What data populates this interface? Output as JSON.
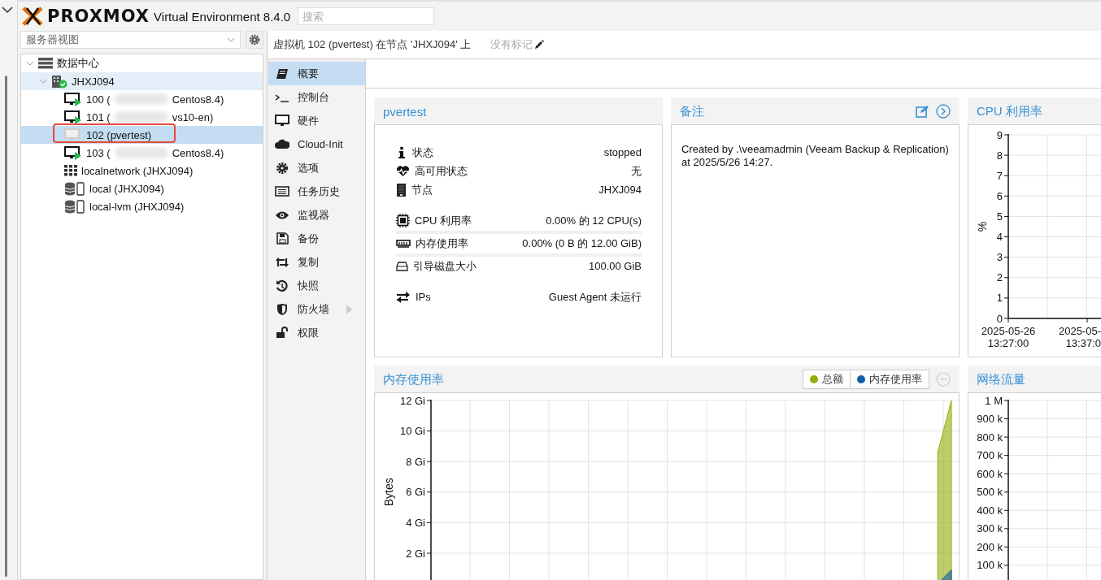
{
  "header": {
    "logo": "PROXMOX",
    "product": "Virtual Environment 8.4.0",
    "search": {
      "placeholder": "搜索"
    }
  },
  "sidebar": {
    "view_selector": {
      "value": "服务器视图"
    },
    "tree": [
      {
        "kind": "datacenter",
        "label": "数据中心",
        "expanded": true,
        "selected": false,
        "highlighted": false,
        "circled": false,
        "children": [
          {
            "kind": "node",
            "label": "JHXJ094",
            "expanded": true,
            "selected": false,
            "highlighted": true,
            "circled": false,
            "children": [
              {
                "kind": "vm",
                "label": "100 (",
                "label_end": "Centos8.4)",
                "running": true,
                "selected": false,
                "highlighted": false,
                "circled": false
              },
              {
                "kind": "vm",
                "label": "101 (",
                "label_end": "vs10-en)",
                "running": true,
                "selected": false,
                "highlighted": false,
                "circled": false
              },
              {
                "kind": "vm",
                "label": "102 (pvertest)",
                "running": false,
                "selected": true,
                "highlighted": false,
                "circled": true
              },
              {
                "kind": "vm",
                "label": "103 (",
                "label_end": "Centos8.4)",
                "running": true,
                "selected": false,
                "highlighted": false,
                "circled": false
              },
              {
                "kind": "sdn",
                "label": "localnetwork (JHXJ094)",
                "selected": false,
                "highlighted": false,
                "circled": false
              },
              {
                "kind": "storage",
                "label": "local (JHXJ094)",
                "selected": false,
                "highlighted": false,
                "circled": false
              },
              {
                "kind": "storage",
                "label": "local-lvm (JHXJ094)",
                "selected": false,
                "highlighted": false,
                "circled": false
              }
            ]
          }
        ]
      }
    ]
  },
  "title_bar": {
    "title": "虚拟机 102 (pvertest) 在节点 'JHXJ094' 上",
    "tags": "没有标记"
  },
  "menu": [
    {
      "label": "概要",
      "selected": true,
      "has_submenu": false
    },
    {
      "label": "控制台",
      "selected": false,
      "has_submenu": false
    },
    {
      "label": "硬件",
      "selected": false,
      "has_submenu": false
    },
    {
      "label": "Cloud-Init",
      "selected": false,
      "has_submenu": false
    },
    {
      "label": "选项",
      "selected": false,
      "has_submenu": false
    },
    {
      "label": "任务历史",
      "selected": false,
      "has_submenu": false
    },
    {
      "label": "监视器",
      "selected": false,
      "has_submenu": false
    },
    {
      "label": "备份",
      "selected": false,
      "has_submenu": false
    },
    {
      "label": "复制",
      "selected": false,
      "has_submenu": false
    },
    {
      "label": "快照",
      "selected": false,
      "has_submenu": false
    },
    {
      "label": "防火墙",
      "selected": false,
      "has_submenu": true
    },
    {
      "label": "权限",
      "selected": false,
      "has_submenu": false
    }
  ],
  "summary": {
    "title": "pvertest",
    "sections": [
      {
        "rows": [
          {
            "kind": "info",
            "label": "状态",
            "value": "stopped"
          },
          {
            "kind": "info",
            "label": "高可用状态",
            "value": "无"
          },
          {
            "kind": "info",
            "label": "节点",
            "value": "JHXJ094"
          }
        ]
      },
      {
        "rows": [
          {
            "kind": "bar",
            "label": "CPU 利用率",
            "value": "0.00% 的 12 CPU(s)",
            "level": 0
          },
          {
            "kind": "bar",
            "label": "内存使用率",
            "value": "0.00% (0 B 的 12.00 GiB)",
            "level": 0
          },
          {
            "kind": "info",
            "label": "引导磁盘大小",
            "value": "100.00 GiB"
          }
        ]
      },
      {
        "rows": [
          {
            "kind": "info",
            "label": "IPs",
            "value": "Guest Agent 未运行"
          }
        ]
      }
    ]
  },
  "notes": {
    "title": "备注",
    "text": "Created by .\\veeamadmin (Veeam Backup & Replication) at 2025/5/26 14:27."
  },
  "cpu": {
    "title": "CPU 利用率",
    "chart_data": {
      "type": "line",
      "grid": true,
      "ylabel": "%",
      "ylim": [
        0,
        9
      ],
      "yticks": [
        0,
        1,
        2,
        3,
        4,
        5,
        6,
        7,
        8,
        9
      ],
      "categories": [
        "2025-05-26 13:27:00",
        "2025-05- 13:37:0"
      ]
    }
  },
  "memory": {
    "title": "内存使用率",
    "chart_data": {
      "type": "area",
      "grid": true,
      "ylabel": "Bytes",
      "ylim": [
        0,
        12
      ],
      "yticks": [
        {
          "value": 2,
          "label": "2 Gi"
        },
        {
          "value": 4,
          "label": "4 Gi"
        },
        {
          "value": 6,
          "label": "6 Gi"
        },
        {
          "value": 8,
          "label": "8 Gi"
        },
        {
          "value": 10,
          "label": "10 Gi"
        },
        {
          "value": 12,
          "label": "12 Gi"
        }
      ],
      "categories": [
        null,
        null,
        null,
        null,
        null,
        null,
        null,
        null,
        null,
        null,
        null,
        null,
        null,
        null,
        null,
        null,
        null,
        null,
        null,
        null,
        null,
        null,
        null,
        null,
        null,
        null,
        null,
        null,
        null,
        null,
        null,
        null,
        null,
        null,
        null,
        null,
        null,
        null,
        null
      ],
      "series": [
        {
          "name": "总额",
          "color": "#94ae0a",
          "values": [
            null,
            null,
            null,
            null,
            null,
            null,
            null,
            null,
            null,
            null,
            null,
            null,
            null,
            null,
            null,
            null,
            null,
            null,
            null,
            null,
            null,
            null,
            null,
            null,
            null,
            null,
            null,
            null,
            null,
            null,
            null,
            null,
            null,
            null,
            null,
            null,
            null,
            8.6,
            12
          ]
        },
        {
          "name": "内存使用率",
          "color": "#115fa6",
          "values": [
            null,
            null,
            null,
            null,
            null,
            null,
            null,
            null,
            null,
            null,
            null,
            null,
            null,
            null,
            null,
            null,
            null,
            null,
            null,
            null,
            null,
            null,
            null,
            null,
            null,
            null,
            null,
            null,
            null,
            null,
            null,
            null,
            null,
            null,
            null,
            null,
            null,
            0,
            0.9
          ]
        }
      ]
    }
  },
  "network": {
    "title": "网络流量",
    "axis_labels": [
      "1 M",
      "900 k",
      "800 k",
      "700 k",
      "600 k",
      "500 k",
      "400 k",
      "300 k",
      "200 k",
      "100 k"
    ]
  }
}
